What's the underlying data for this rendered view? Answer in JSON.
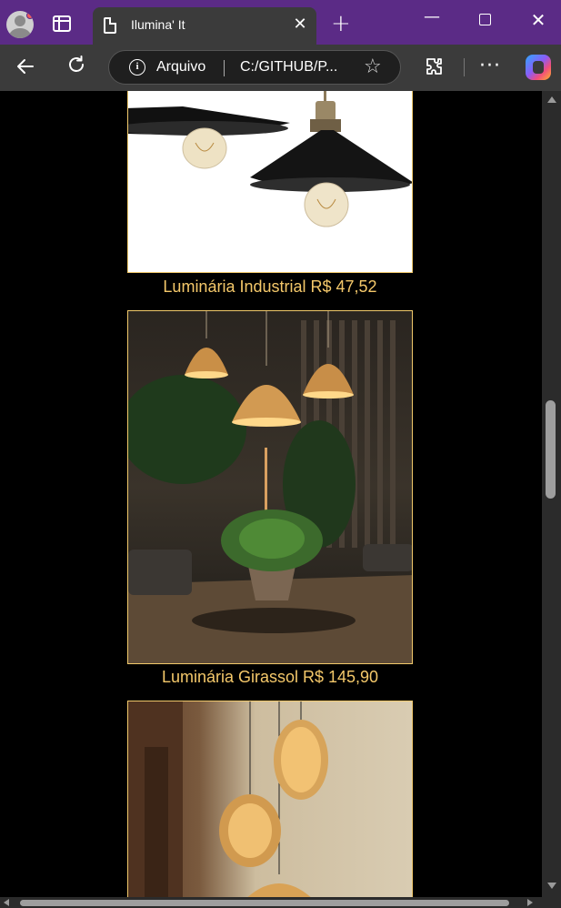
{
  "browser": {
    "tab_title": "Ilumina' It",
    "close_tab_label": "✕",
    "new_tab_label": "+",
    "address": {
      "scheme_label": "Arquivo",
      "url": "C:/GITHUB/P..."
    },
    "window": {
      "minimize": "—",
      "close": "✕"
    },
    "more_label": "···"
  },
  "products": [
    {
      "name_price": "Luminária Industrial R$ 47,52",
      "image": "industrial-black-pendant-lamps"
    },
    {
      "name_price": "Luminária Girassol R$ 145,90",
      "image": "woven-pendant-lamps-over-dining-table"
    },
    {
      "image": "rattan-pendant-lamps-cabinet"
    }
  ],
  "colors": {
    "tabbar": "#5b2b86",
    "toolbar": "#3b3b3b",
    "page_bg": "#000000",
    "caption": "#f4c86a",
    "image_border": "#f1c96b"
  }
}
